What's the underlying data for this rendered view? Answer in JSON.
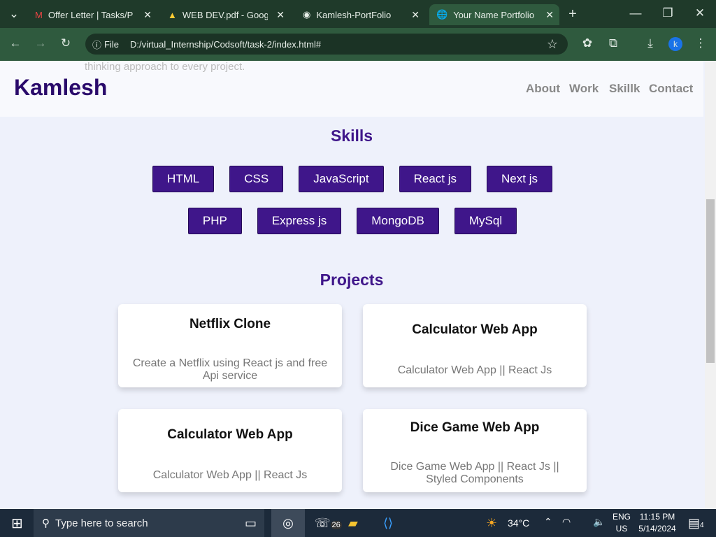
{
  "browser": {
    "tabs": [
      {
        "label": "Offer Letter | Tasks/Pro"
      },
      {
        "label": "WEB DEV.pdf - Google"
      },
      {
        "label": "Kamlesh-PortFolio"
      },
      {
        "label": "Your Name Portfolio"
      }
    ],
    "security_label": "File",
    "url": "D:/virtual_Internship/Codsoft/task-2/index.html#",
    "profile_initial": "k"
  },
  "page": {
    "ghost_text": "thinking approach to every project.",
    "brand": "Kamlesh",
    "nav": [
      "About",
      "Work",
      "Skillk",
      "Contact"
    ],
    "skills_title": "Skills",
    "skills": [
      "HTML",
      "CSS",
      "JavaScript",
      "React js",
      "Next js",
      "PHP",
      "Express js",
      "MongoDB",
      "MySql"
    ],
    "projects_title": "Projects",
    "projects": [
      {
        "title": "Netflix Clone",
        "desc": "Create a Netflix using React js and free Api service"
      },
      {
        "title": "Calculator Web App",
        "desc": "Calculator Web App || React Js"
      },
      {
        "title": "Calculator Web App",
        "desc": "Calculator Web App || React Js"
      },
      {
        "title": "Dice Game Web App",
        "desc": "Dice Game Web App || React Js || Styled Components"
      }
    ]
  },
  "taskbar": {
    "search_placeholder": "Type here to search",
    "whatsapp_badge": "26",
    "weather": "34°C",
    "weather_badge": "1",
    "lang": "ENG",
    "region": "US",
    "time": "11:15 PM",
    "date": "5/14/2024",
    "notif": "4"
  },
  "colors": {
    "accent": "#3f168a",
    "brand": "#2a0a6b"
  }
}
